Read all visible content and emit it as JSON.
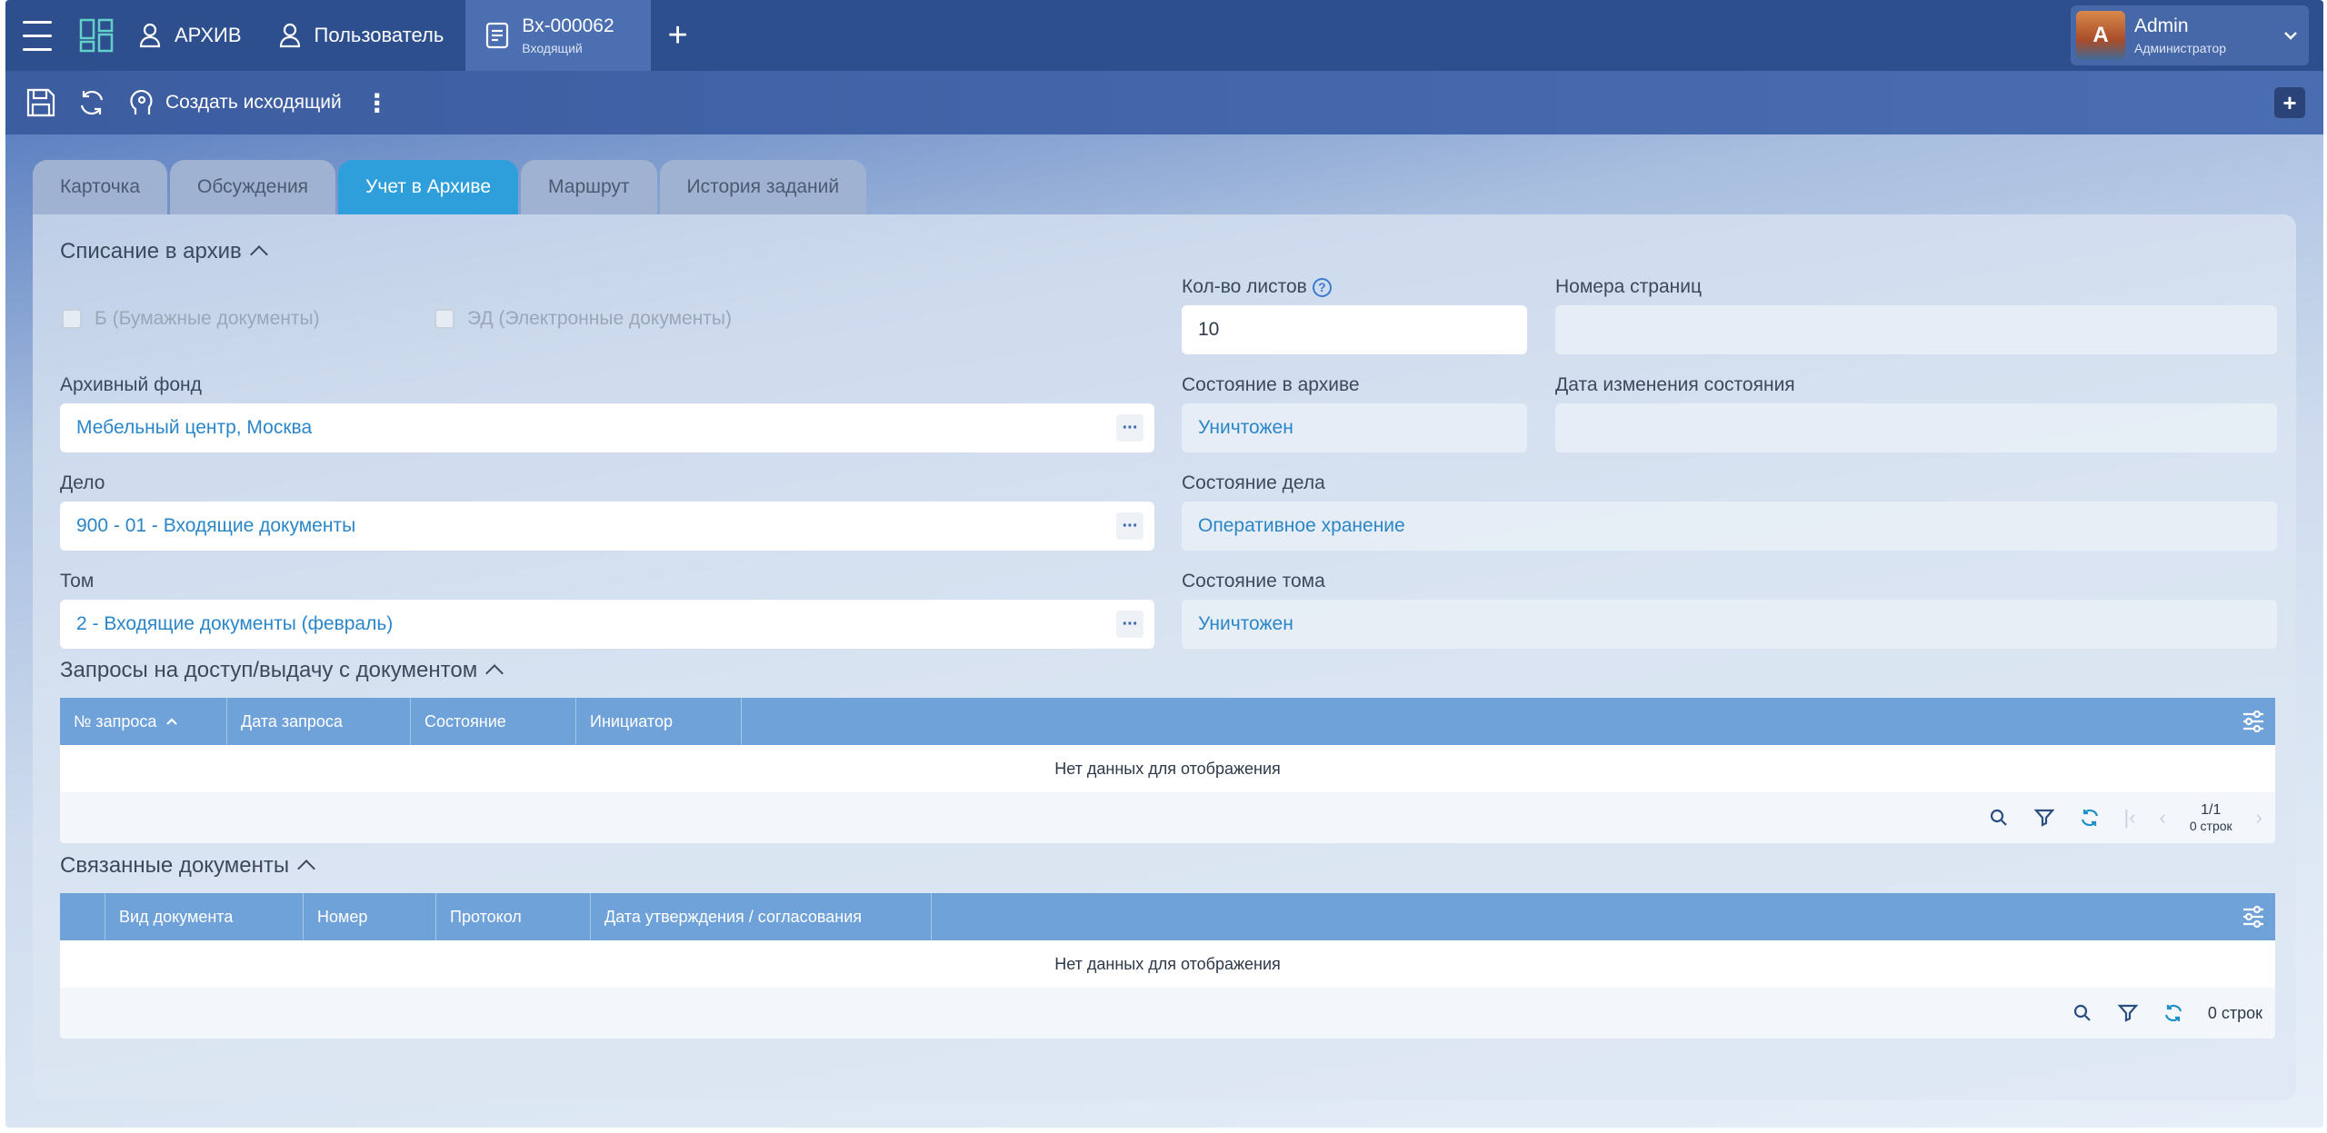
{
  "nav": {
    "archive_label": "АРХИВ",
    "user_label": "Пользователь",
    "doc_tab_title": "Вх-000062",
    "doc_tab_subtitle": "Входящий",
    "user": {
      "name": "Admin",
      "role": "Администратор"
    }
  },
  "toolbar": {
    "create_outgoing_label": "Создать исходящий"
  },
  "tabs": [
    {
      "label": "Карточка"
    },
    {
      "label": "Обсуждения"
    },
    {
      "label": "Учет в Архиве"
    },
    {
      "label": "Маршрут"
    },
    {
      "label": "История заданий"
    }
  ],
  "archive_section": {
    "title": "Списание в архив",
    "paper_docs": "Б (Бумажные документы)",
    "electronic_docs": "ЭД (Электронные документы)",
    "sheets_label": "Кол-во листов",
    "sheets_value": "10",
    "pages_label": "Номера страниц",
    "pages_value": "",
    "fund_label": "Архивный фонд",
    "fund_value": "Мебельный центр, Москва",
    "archive_state_label": "Состояние в архиве",
    "archive_state_value": "Уничтожен",
    "state_change_date_label": "Дата изменения состояния",
    "state_change_date_value": "",
    "case_label": "Дело",
    "case_value": "900 - 01 - Входящие документы",
    "case_state_label": "Состояние дела",
    "case_state_value": "Оперативное хранение",
    "volume_label": "Том",
    "volume_value": "2 - Входящие документы (февраль)",
    "volume_state_label": "Состояние тома",
    "volume_state_value": "Уничтожен"
  },
  "requests": {
    "title": "Запросы на доступ/выдачу с документом",
    "columns": [
      "№ запроса",
      "Дата запроса",
      "Состояние",
      "Инициатор"
    ],
    "empty_text": "Нет данных для отображения",
    "page": "1/1",
    "rows_count": "0 строк"
  },
  "linked": {
    "title": "Связанные документы",
    "columns": [
      "Вид документа",
      "Номер",
      "Протокол",
      "Дата утверждения / согласования"
    ],
    "empty_text": "Нет данных для отображения",
    "rows_count": "0 строк"
  },
  "colors": {
    "nav": "#2e4f8e",
    "active_tab": "#2f9fdc",
    "grid_header": "#70a2da",
    "link": "#2b86c7"
  }
}
